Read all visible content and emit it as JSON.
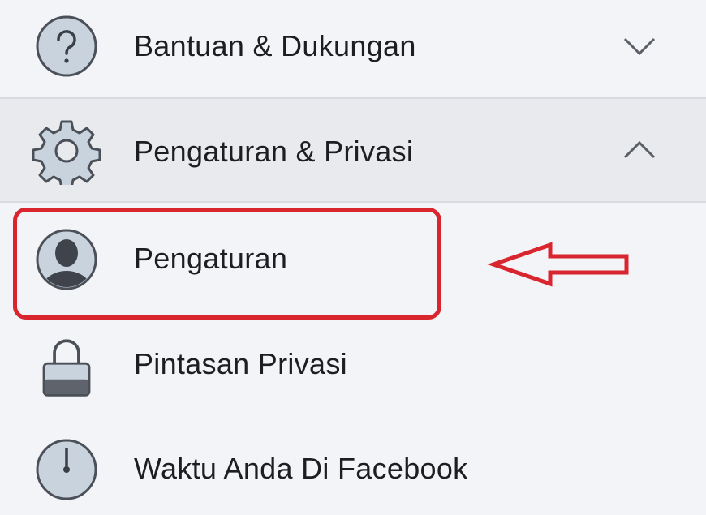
{
  "menu": {
    "help": {
      "label": "Bantuan & Dukungan",
      "icon": "question-circle-icon",
      "expanded": false
    },
    "settings_privacy": {
      "label": "Pengaturan & Privasi",
      "icon": "gear-icon",
      "expanded": true
    },
    "settings": {
      "label": "Pengaturan",
      "icon": "profile-avatar-icon"
    },
    "privacy_shortcuts": {
      "label": "Pintasan Privasi",
      "icon": "lock-icon"
    },
    "time_on_facebook": {
      "label": "Waktu Anda Di Facebook",
      "icon": "clock-icon"
    }
  },
  "annotation": {
    "highlight_color": "#d9252e",
    "arrow_icon": "left-arrow-icon"
  }
}
